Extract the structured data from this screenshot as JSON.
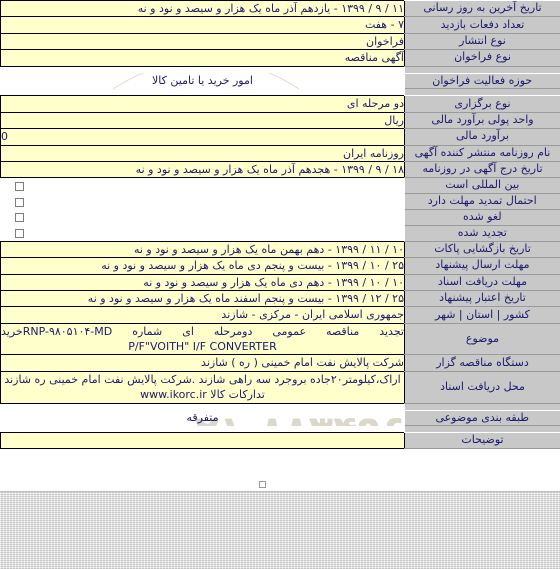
{
  "page": {
    "direction": "rtl",
    "accent_label_bg": "#c8c8c8",
    "value_bg": "#ffffcc",
    "text_color": "#1b1b6b"
  },
  "watermark": {
    "phone": "۰۲۱-۸۸۳۴۹۶۷۰",
    "digits": "0101",
    "brand": "Parsnamaddata",
    "brand2": "پارس نماد داده",
    "brand3": "مرکز اطلاعات"
  },
  "rows": [
    {
      "label": "تاریخ آخرین به روز رسانی",
      "value": "۱۱ / ۹ / ۱۳۹۹ - یازدهم آذر ماه یک هزار و سیصد و نود و نه",
      "type": "value",
      "name": "last-update-date"
    },
    {
      "label": "تعداد دفعات بازدید",
      "value": "۷ - هفت",
      "type": "value",
      "name": "visit-count"
    },
    {
      "label": "نوع انتشار",
      "value": "فراخوان",
      "type": "value",
      "name": "publication-type"
    },
    {
      "label": "نوع فراخوان",
      "value": "آگهی مناقصه",
      "type": "value",
      "name": "announcement-type"
    },
    {
      "label": "حوزه فعالیت فراخوان",
      "value": "امور خرید یا تامین کالا",
      "type": "plain",
      "name": "activity-field"
    },
    {
      "label": "نوع برگزاری",
      "value": "دو مرحله ای",
      "type": "value",
      "name": "holding-type"
    },
    {
      "label": "واحد پولی برآورد مالی",
      "value": "ریال",
      "type": "value",
      "name": "currency-unit"
    },
    {
      "label": "برآورد مالی",
      "value": "0",
      "type": "value-ltr",
      "name": "financial-estimate"
    },
    {
      "label": "نام روزنامه منتشر کننده آگهی",
      "value": "روزنامه ایران",
      "type": "value",
      "name": "newspaper-name"
    },
    {
      "label": "تاریخ درج آگهی در روزنامه",
      "value": "۱۸ / ۹ / ۱۳۹۹ - هجدهم آذر ماه یک هزار و سیصد و نود و نه",
      "type": "value",
      "name": "newspaper-publish-date"
    },
    {
      "label": "بین المللی است",
      "value": "",
      "type": "checkbox",
      "checked": false,
      "name": "is-international"
    },
    {
      "label": "احتمال تمدید مهلت دارد",
      "value": "",
      "type": "checkbox",
      "checked": false,
      "name": "extension-possible"
    },
    {
      "label": "لغو شده",
      "value": "",
      "type": "checkbox",
      "checked": false,
      "name": "is-cancelled"
    },
    {
      "label": "تجدید شده",
      "value": "",
      "type": "checkbox",
      "checked": false,
      "name": "is-renewed"
    },
    {
      "label": "تاریخ بازگشایی پاکات",
      "value": "۱۰ / ۱۱ / ۱۳۹۹ - دهم بهمن ماه یک هزار و سیصد و نود و نه",
      "type": "value",
      "name": "envelope-opening-date"
    },
    {
      "label": "مهلت ارسال پیشنهاد",
      "value": "۲۵ / ۱۰ / ۱۳۹۹ - بیست و پنجم دی ماه یک هزار و سیصد و نود و نه",
      "type": "value",
      "name": "proposal-submission-deadline"
    },
    {
      "label": "مهلت دریافت اسناد",
      "value": "۱۰ / ۱۰ / ۱۳۹۹ - دهم دی ماه یک هزار و سیصد و نود و نه",
      "type": "value",
      "name": "document-receipt-deadline"
    },
    {
      "label": "تاریخ اعتبار پیشنهاد",
      "value": "۲۵ / ۱۲ / ۱۳۹۹ - بیست و پنجم اسفند ماه یک هزار و سیصد و نود و نه",
      "type": "value",
      "name": "proposal-validity-date"
    },
    {
      "label": "کشور | استان | شهر",
      "value": "جمهوری اسلامی ایران - مرکزی - شازند",
      "type": "value",
      "name": "country-province-city"
    },
    {
      "label": "موضوع",
      "value": "تجدید مناقصه عمومی دومرحله ای شماره RNP-۹۸۰۵۱۰۴-MDخرید",
      "value_en": "P/F\"VOITH\" I/F CONVERTER",
      "type": "subject",
      "name": "subject"
    },
    {
      "label": "دستگاه مناقصه گزار",
      "value": "شرکت پالایش نفت امام خمینی ( ره ) شازند",
      "type": "value",
      "name": "tender-authority"
    },
    {
      "label": "محل دریافت اسناد",
      "value": "اراک،کیلومتر۲۰جاده بروجرد سه راهی شازند .شرکت پالایش نفت امام خمینی ره شازند تدارکات کالا www.ikorc.ir",
      "type": "value-multiline",
      "name": "document-receipt-location"
    },
    {
      "label": "طبقه بندی موضوعی",
      "value": "متفرقه",
      "type": "plain",
      "name": "subject-classification"
    },
    {
      "label": "توضیحات",
      "value": "",
      "type": "value",
      "name": "description"
    }
  ]
}
